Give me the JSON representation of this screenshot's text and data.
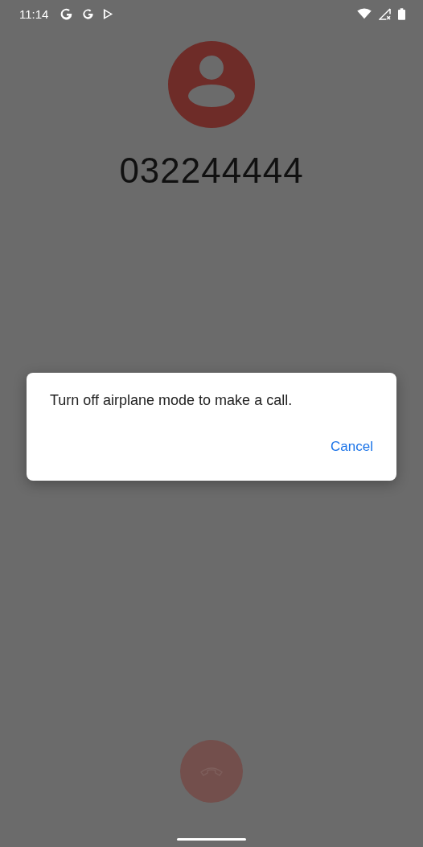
{
  "status_bar": {
    "time": "11:14"
  },
  "call": {
    "number": "032244444"
  },
  "dialog": {
    "message": "Turn off airplane mode to make a call.",
    "buttons": [
      "Cancel"
    ]
  }
}
